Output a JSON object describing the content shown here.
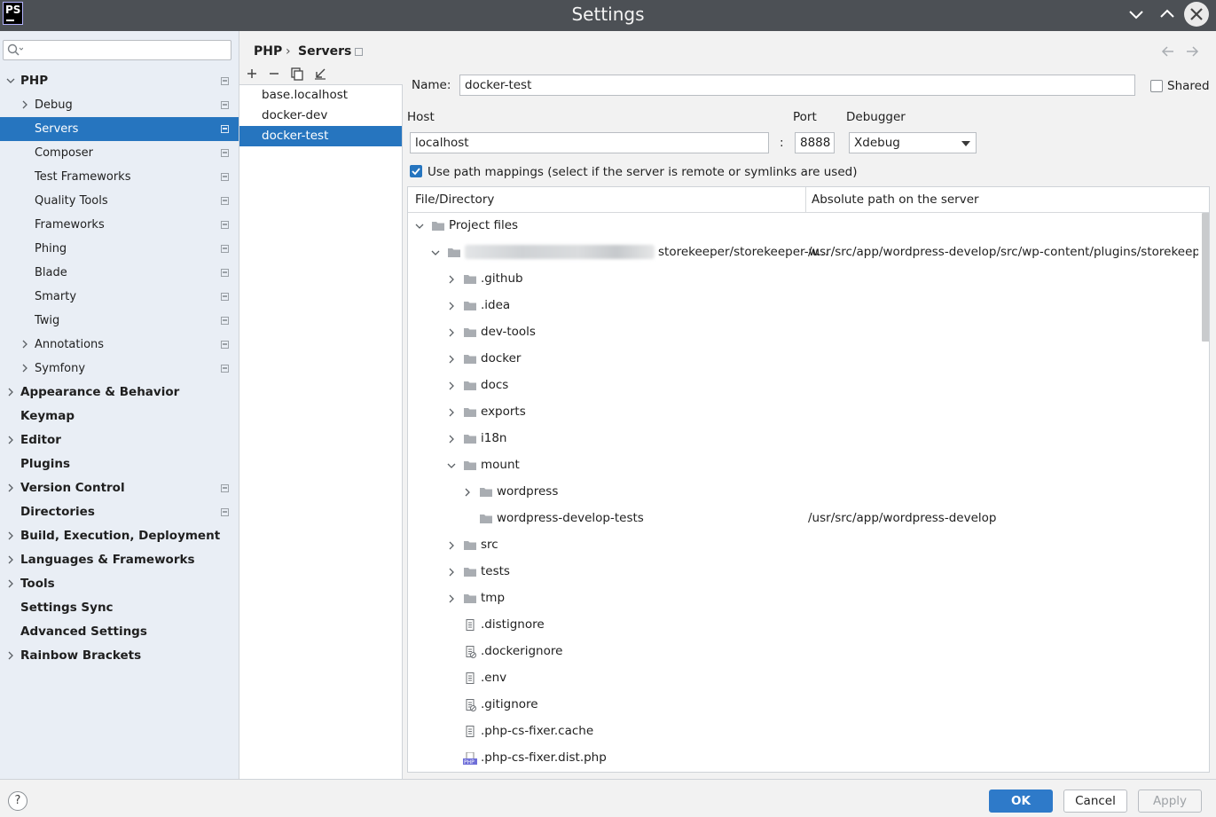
{
  "window": {
    "title": "Settings",
    "logo_text": "PS"
  },
  "search": {
    "placeholder": "",
    "value": ""
  },
  "sidebar": {
    "items": [
      {
        "label": "PHP",
        "bold": true,
        "expanded": true,
        "level": 0
      },
      {
        "label": "Debug",
        "bold": false,
        "expandable": true,
        "level": 1
      },
      {
        "label": "Servers",
        "bold": false,
        "level": 1,
        "selected": true
      },
      {
        "label": "Composer",
        "bold": false,
        "level": 1
      },
      {
        "label": "Test Frameworks",
        "bold": false,
        "level": 1
      },
      {
        "label": "Quality Tools",
        "bold": false,
        "level": 1
      },
      {
        "label": "Frameworks",
        "bold": false,
        "level": 1
      },
      {
        "label": "Phing",
        "bold": false,
        "level": 1
      },
      {
        "label": "Blade",
        "bold": false,
        "level": 1
      },
      {
        "label": "Smarty",
        "bold": false,
        "level": 1
      },
      {
        "label": "Twig",
        "bold": false,
        "level": 1
      },
      {
        "label": "Annotations",
        "bold": false,
        "expandable": true,
        "level": 1
      },
      {
        "label": "Symfony",
        "bold": false,
        "expandable": true,
        "level": 1
      },
      {
        "label": "Appearance & Behavior",
        "bold": true,
        "expandable": true,
        "level": 0
      },
      {
        "label": "Keymap",
        "bold": true,
        "level": 0
      },
      {
        "label": "Editor",
        "bold": true,
        "expandable": true,
        "level": 0
      },
      {
        "label": "Plugins",
        "bold": true,
        "level": 0
      },
      {
        "label": "Version Control",
        "bold": true,
        "expandable": true,
        "level": 0
      },
      {
        "label": "Directories",
        "bold": true,
        "level": 0
      },
      {
        "label": "Build, Execution, Deployment",
        "bold": true,
        "expandable": true,
        "level": 0
      },
      {
        "label": "Languages & Frameworks",
        "bold": true,
        "expandable": true,
        "level": 0
      },
      {
        "label": "Tools",
        "bold": true,
        "expandable": true,
        "level": 0
      },
      {
        "label": "Settings Sync",
        "bold": true,
        "level": 0
      },
      {
        "label": "Advanced Settings",
        "bold": true,
        "level": 0
      },
      {
        "label": "Rainbow Brackets",
        "bold": true,
        "expandable": true,
        "level": 0
      }
    ]
  },
  "breadcrumb": {
    "parent": "PHP",
    "separator": "›",
    "current": "Servers"
  },
  "servers": {
    "toolbar": [
      "add-icon",
      "remove-icon",
      "copy-icon",
      "import-icon"
    ],
    "items": [
      "base.localhost",
      "docker-dev",
      "docker-test"
    ],
    "selected": "docker-test"
  },
  "form": {
    "name_label": "Name:",
    "name_value": "docker-test",
    "shared_label": "Shared",
    "shared_checked": false,
    "host_label": "Host",
    "host_value": "localhost",
    "port_label": "Port",
    "port_separator": ":",
    "port_value": "8888",
    "debugger_label": "Debugger",
    "debugger_value": "Xdebug",
    "path_mappings_label": "Use path mappings (select if the server is remote or symlinks are used)",
    "path_mappings_checked": true
  },
  "mappings": {
    "columns": [
      "File/Directory",
      "Absolute path on the server"
    ],
    "rows": [
      {
        "name": "Project files",
        "depth": 0,
        "toggle": "open",
        "icon": "folder",
        "path": ""
      },
      {
        "name": "storekeeper/storekeeper-w...",
        "depth": 1,
        "toggle": "open",
        "icon": "folder",
        "path": "/usr/src/app/wordpress-develop/src/wp-content/plugins/storekeepe...",
        "blurred_prefix": true
      },
      {
        "name": ".github",
        "depth": 2,
        "toggle": "closed",
        "icon": "folder",
        "path": ""
      },
      {
        "name": ".idea",
        "depth": 2,
        "toggle": "closed",
        "icon": "folder",
        "path": ""
      },
      {
        "name": "dev-tools",
        "depth": 2,
        "toggle": "closed",
        "icon": "folder",
        "path": ""
      },
      {
        "name": "docker",
        "depth": 2,
        "toggle": "closed",
        "icon": "folder",
        "path": ""
      },
      {
        "name": "docs",
        "depth": 2,
        "toggle": "closed",
        "icon": "folder",
        "path": ""
      },
      {
        "name": "exports",
        "depth": 2,
        "toggle": "closed",
        "icon": "folder",
        "path": ""
      },
      {
        "name": "i18n",
        "depth": 2,
        "toggle": "closed",
        "icon": "folder",
        "path": ""
      },
      {
        "name": "mount",
        "depth": 2,
        "toggle": "open",
        "icon": "folder",
        "path": ""
      },
      {
        "name": "wordpress",
        "depth": 3,
        "toggle": "closed",
        "icon": "folder",
        "path": ""
      },
      {
        "name": "wordpress-develop-tests",
        "depth": 3,
        "toggle": "none",
        "icon": "folder",
        "path": "/usr/src/app/wordpress-develop"
      },
      {
        "name": "src",
        "depth": 2,
        "toggle": "closed",
        "icon": "folder",
        "path": ""
      },
      {
        "name": "tests",
        "depth": 2,
        "toggle": "closed",
        "icon": "folder",
        "path": ""
      },
      {
        "name": "tmp",
        "depth": 2,
        "toggle": "closed",
        "icon": "folder",
        "path": ""
      },
      {
        "name": ".distignore",
        "depth": 2,
        "toggle": "none",
        "icon": "file",
        "path": ""
      },
      {
        "name": ".dockerignore",
        "depth": 2,
        "toggle": "none",
        "icon": "ignore-file",
        "path": ""
      },
      {
        "name": ".env",
        "depth": 2,
        "toggle": "none",
        "icon": "file",
        "path": ""
      },
      {
        "name": ".gitignore",
        "depth": 2,
        "toggle": "none",
        "icon": "ignore-file",
        "path": ""
      },
      {
        "name": ".php-cs-fixer.cache",
        "depth": 2,
        "toggle": "none",
        "icon": "file",
        "path": ""
      },
      {
        "name": ".php-cs-fixer.dist.php",
        "depth": 2,
        "toggle": "none",
        "icon": "php-file",
        "path": "",
        "icon_text": "PHP"
      }
    ]
  },
  "footer": {
    "help": "?",
    "ok": "OK",
    "cancel": "Cancel",
    "apply": "Apply",
    "apply_enabled": false
  },
  "colors": {
    "accent": "#2675bf",
    "titlebar": "#4c5055",
    "sidebar_bg": "#e9eef5"
  }
}
